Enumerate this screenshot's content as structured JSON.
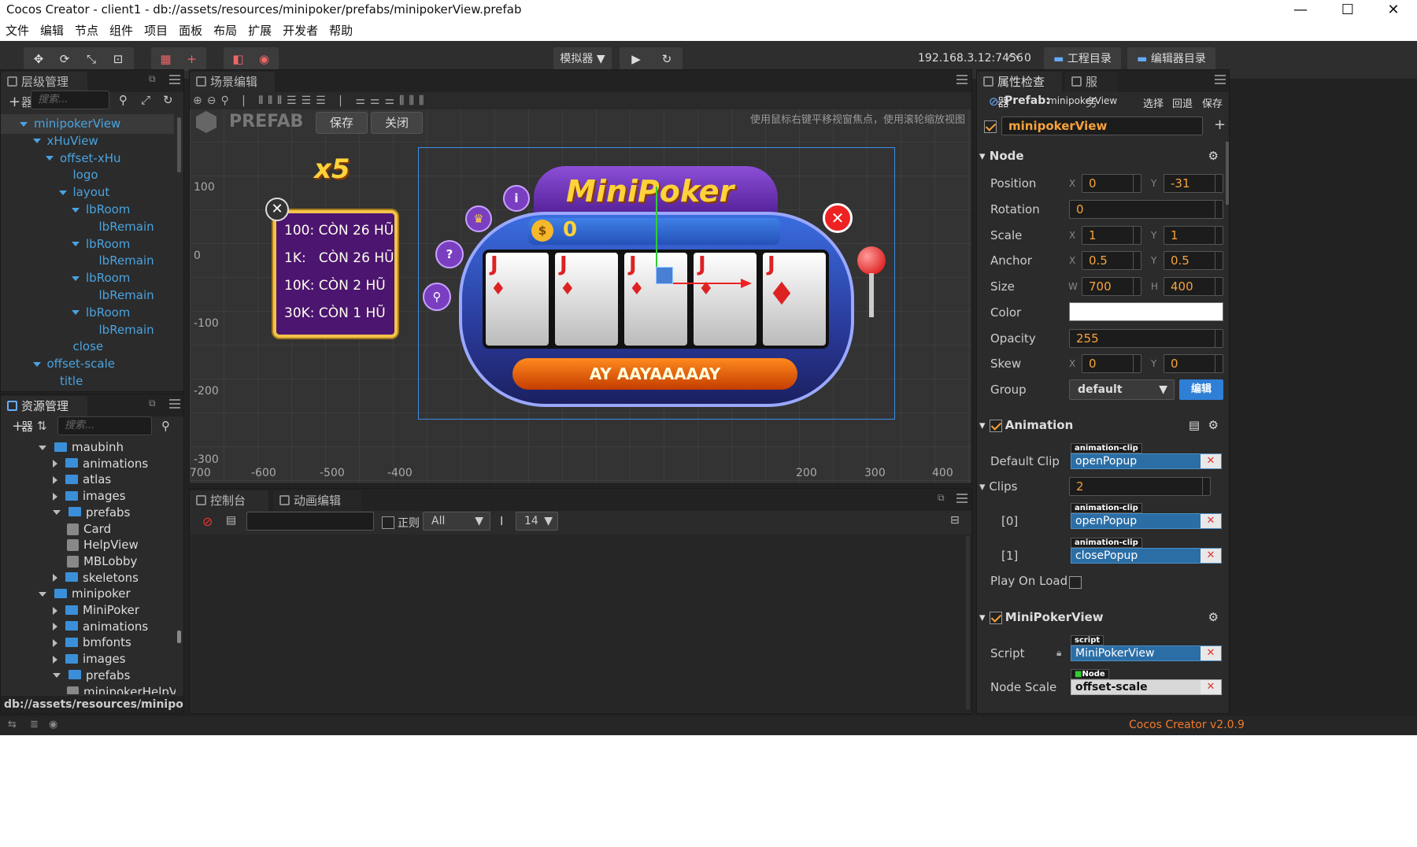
{
  "window": {
    "title": "Cocos Creator - client1 - db://assets/resources/minipoker/prefabs/minipokerView.prefab"
  },
  "menu": [
    "文件",
    "编辑",
    "节点",
    "组件",
    "项目",
    "面板",
    "布局",
    "扩展",
    "开发者",
    "帮助"
  ],
  "toolbar": {
    "simulator": "模拟器 ▼",
    "ip": "192.168.3.12:7456",
    "conn_count": "0",
    "project_dir": "工程目录",
    "editor_dir": "编辑器目录"
  },
  "hierarchy": {
    "title": "层级管理器",
    "search_placeholder": "搜索...",
    "items": [
      {
        "label": "minipokerView",
        "depth": 0,
        "expanded": true
      },
      {
        "label": "xHuView",
        "depth": 1,
        "expanded": true
      },
      {
        "label": "offset-xHu",
        "depth": 2,
        "expanded": true
      },
      {
        "label": "logo",
        "depth": 3,
        "expanded": false
      },
      {
        "label": "layout",
        "depth": 3,
        "expanded": true
      },
      {
        "label": "lbRoom",
        "depth": 4,
        "expanded": true
      },
      {
        "label": "lbRemain",
        "depth": 5,
        "expanded": false
      },
      {
        "label": "lbRoom",
        "depth": 4,
        "expanded": true
      },
      {
        "label": "lbRemain",
        "depth": 5,
        "expanded": false
      },
      {
        "label": "lbRoom",
        "depth": 4,
        "expanded": true
      },
      {
        "label": "lbRemain",
        "depth": 5,
        "expanded": false
      },
      {
        "label": "lbRoom",
        "depth": 4,
        "expanded": true
      },
      {
        "label": "lbRemain",
        "depth": 5,
        "expanded": false
      },
      {
        "label": "close",
        "depth": 3,
        "expanded": false
      },
      {
        "label": "offset-scale",
        "depth": 1,
        "expanded": true
      },
      {
        "label": "title",
        "depth": 2,
        "expanded": false
      }
    ]
  },
  "assets": {
    "title": "资源管理器",
    "search_placeholder": "搜索...",
    "path": "db://assets/resources/minipoker/p...",
    "items": [
      {
        "label": "maubinh",
        "depth": 0,
        "kind": "folder",
        "open": true
      },
      {
        "label": "animations",
        "depth": 1,
        "kind": "folder",
        "open": false
      },
      {
        "label": "atlas",
        "depth": 1,
        "kind": "folder",
        "open": false
      },
      {
        "label": "images",
        "depth": 1,
        "kind": "folder",
        "open": false
      },
      {
        "label": "prefabs",
        "depth": 1,
        "kind": "folder",
        "open": true
      },
      {
        "label": "Card",
        "depth": 2,
        "kind": "prefab"
      },
      {
        "label": "HelpView",
        "depth": 2,
        "kind": "prefab"
      },
      {
        "label": "MBLobby",
        "depth": 2,
        "kind": "prefab"
      },
      {
        "label": "skeletons",
        "depth": 1,
        "kind": "folder",
        "open": false
      },
      {
        "label": "minipoker",
        "depth": 0,
        "kind": "folder",
        "open": true
      },
      {
        "label": "MiniPoker",
        "depth": 1,
        "kind": "folder",
        "open": false
      },
      {
        "label": "animations",
        "depth": 1,
        "kind": "folder",
        "open": false
      },
      {
        "label": "bmfonts",
        "depth": 1,
        "kind": "folder",
        "open": false
      },
      {
        "label": "images",
        "depth": 1,
        "kind": "folder",
        "open": false
      },
      {
        "label": "prefabs",
        "depth": 1,
        "kind": "folder",
        "open": true
      },
      {
        "label": "minipokerHelpView",
        "depth": 2,
        "kind": "prefab"
      }
    ]
  },
  "scene": {
    "title": "场景编辑器",
    "prefab_label": "PREFAB",
    "save": "保存",
    "close": "关闭",
    "hint": "使用鼠标右键平移视窗焦点，使用滚轮缩放视图",
    "y_ticks": [
      "100",
      "0",
      "-100",
      "-200",
      "-300"
    ],
    "x_ticks": [
      "700",
      "-600",
      "-500",
      "-400",
      "200",
      "300",
      "400"
    ],
    "game": {
      "multiplier": "x5",
      "jackpots": [
        {
          "room": "100:",
          "text": "CÒN 26 HŨ"
        },
        {
          "room": "1K:",
          "text": "CÒN 26 HŨ"
        },
        {
          "room": "10K:",
          "text": "CÒN 2 HŨ"
        },
        {
          "room": "30K:",
          "text": "CÒN 1 HŨ"
        }
      ],
      "logo": "MiniPoker",
      "coins": "0",
      "card_rank": "J",
      "banner": "AY  AAYAAAAAY"
    }
  },
  "console": {
    "tab1": "控制台",
    "tab2": "动画编辑器",
    "regex_label": "正则",
    "level": "All",
    "font_size": "14"
  },
  "inspector": {
    "tab1": "属性检查器",
    "tab2": "服务",
    "prefab_label": "Prefab:",
    "prefab_name": "minipokerView",
    "select": "选择",
    "revert": "回退",
    "save": "保存",
    "node_name": "minipokerView",
    "node": {
      "title": "Node",
      "position": {
        "label": "Position",
        "x": "0",
        "y": "-31"
      },
      "rotation": {
        "label": "Rotation",
        "v": "0"
      },
      "scale": {
        "label": "Scale",
        "x": "1",
        "y": "1"
      },
      "anchor": {
        "label": "Anchor",
        "x": "0.5",
        "y": "0.5"
      },
      "size": {
        "label": "Size",
        "w": "700",
        "h": "400"
      },
      "color": {
        "label": "Color",
        "value": "#ffffff"
      },
      "opacity": {
        "label": "Opacity",
        "v": "255"
      },
      "skew": {
        "label": "Skew",
        "x": "0",
        "y": "0"
      },
      "group": {
        "label": "Group",
        "v": "default",
        "edit": "编辑"
      }
    },
    "animation": {
      "title": "Animation",
      "default_clip_label": "Default Clip",
      "default_clip": "openPopup",
      "clip_tag": "animation-clip",
      "clips_label": "Clips",
      "clips_count": "2",
      "clip0_label": "[0]",
      "clip0": "openPopup",
      "clip1_label": "[1]",
      "clip1": "closePopup",
      "play_on_load": "Play On Load"
    },
    "component": {
      "title": "MiniPokerView",
      "script_label": "Script",
      "script_tag": "script",
      "script": "MiniPokerView",
      "node_scale_label": "Node Scale",
      "node_tag": "Node",
      "node_scale": "offset-scale"
    }
  },
  "status": {
    "version": "Cocos Creator v2.0.9"
  },
  "colors": {
    "accent": "#f7a23b",
    "link": "#4aa3df",
    "bg": "#2b2b2b"
  }
}
